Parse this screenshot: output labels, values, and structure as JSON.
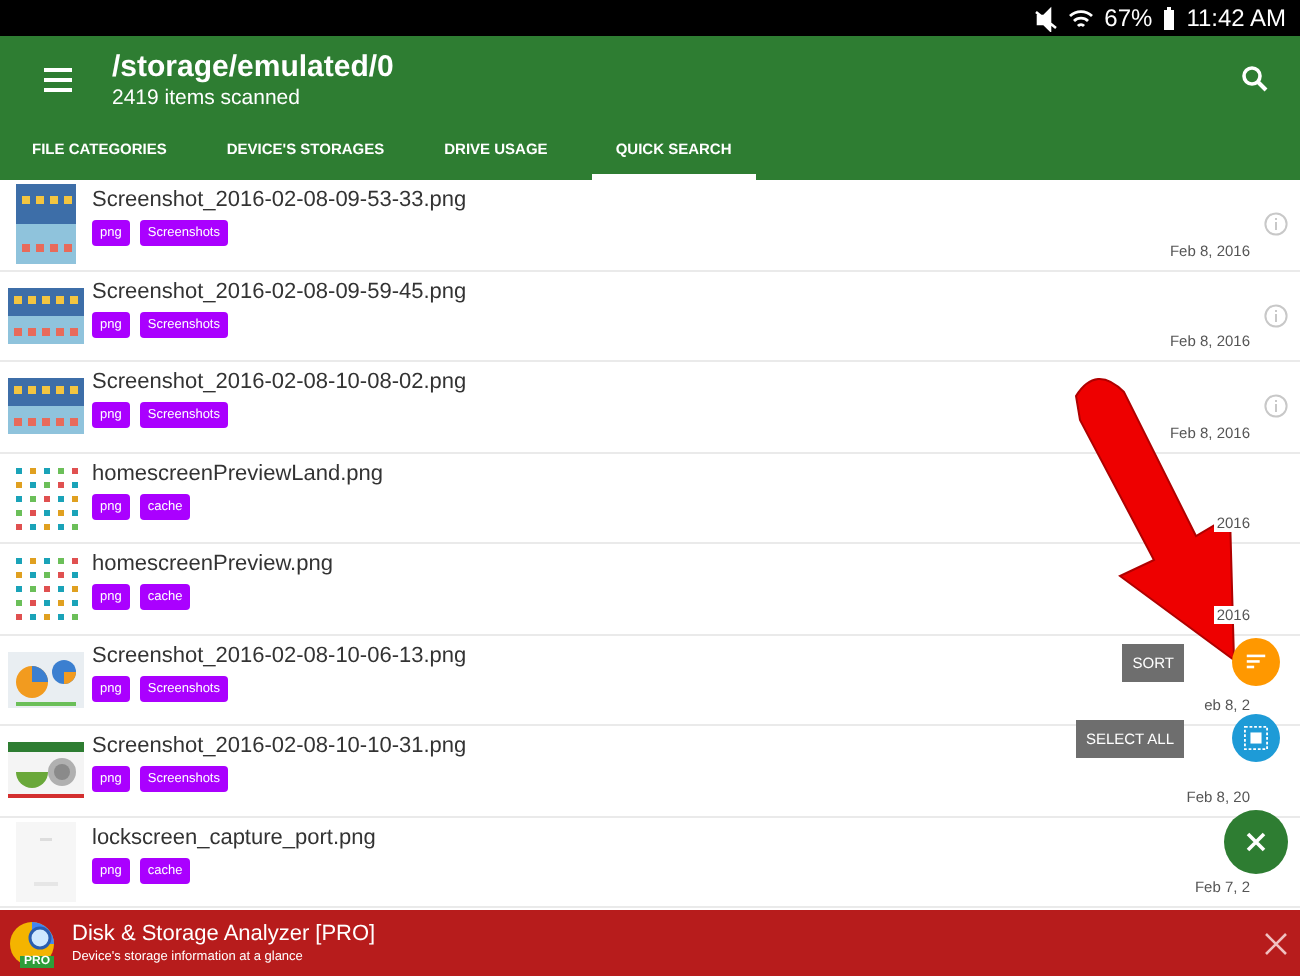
{
  "status_bar": {
    "battery": "67%",
    "time": "11:42 AM"
  },
  "toolbar": {
    "title": "/storage/emulated/0",
    "subtitle": "2419 items scanned"
  },
  "tabs": [
    {
      "label": "FILE CATEGORIES",
      "selected": false
    },
    {
      "label": "DEVICE'S STORAGES",
      "selected": false
    },
    {
      "label": "DRIVE USAGE",
      "selected": false
    },
    {
      "label": "QUICK SEARCH",
      "selected": true
    }
  ],
  "files": [
    {
      "name": "Screenshot_2016-02-08-09-53-33.png",
      "tags": [
        "png",
        "Screenshots"
      ],
      "date": "Feb 8, 2016",
      "info_icon": true
    },
    {
      "name": "Screenshot_2016-02-08-09-59-45.png",
      "tags": [
        "png",
        "Screenshots"
      ],
      "date": "Feb 8, 2016",
      "info_icon": true
    },
    {
      "name": "Screenshot_2016-02-08-10-08-02.png",
      "tags": [
        "png",
        "Screenshots"
      ],
      "date": "Feb 8, 2016",
      "info_icon": true
    },
    {
      "name": "homescreenPreviewLand.png",
      "tags": [
        "png",
        "cache"
      ],
      "date": "2016",
      "info_icon": false
    },
    {
      "name": "homescreenPreview.png",
      "tags": [
        "png",
        "cache"
      ],
      "date": "2016",
      "info_icon": false
    },
    {
      "name": "Screenshot_2016-02-08-10-06-13.png",
      "tags": [
        "png",
        "Screenshots"
      ],
      "date": "eb 8, 2",
      "info_icon": false
    },
    {
      "name": "Screenshot_2016-02-08-10-10-31.png",
      "tags": [
        "png",
        "Screenshots"
      ],
      "date": "Feb 8, 20",
      "info_icon": false
    },
    {
      "name": "lockscreen_capture_port.png",
      "tags": [
        "png",
        "cache"
      ],
      "date": "Feb 7, 2",
      "info_icon": false
    }
  ],
  "fab_actions": [
    {
      "label": "SORT",
      "kind": "sort",
      "color": "#ff9800"
    },
    {
      "label": "SELECT ALL",
      "kind": "select",
      "color": "#1e9bd7"
    }
  ],
  "banner": {
    "title": "Disk & Storage Analyzer [PRO]",
    "subtitle": "Device's storage information at a glance",
    "badge": "PRO"
  }
}
